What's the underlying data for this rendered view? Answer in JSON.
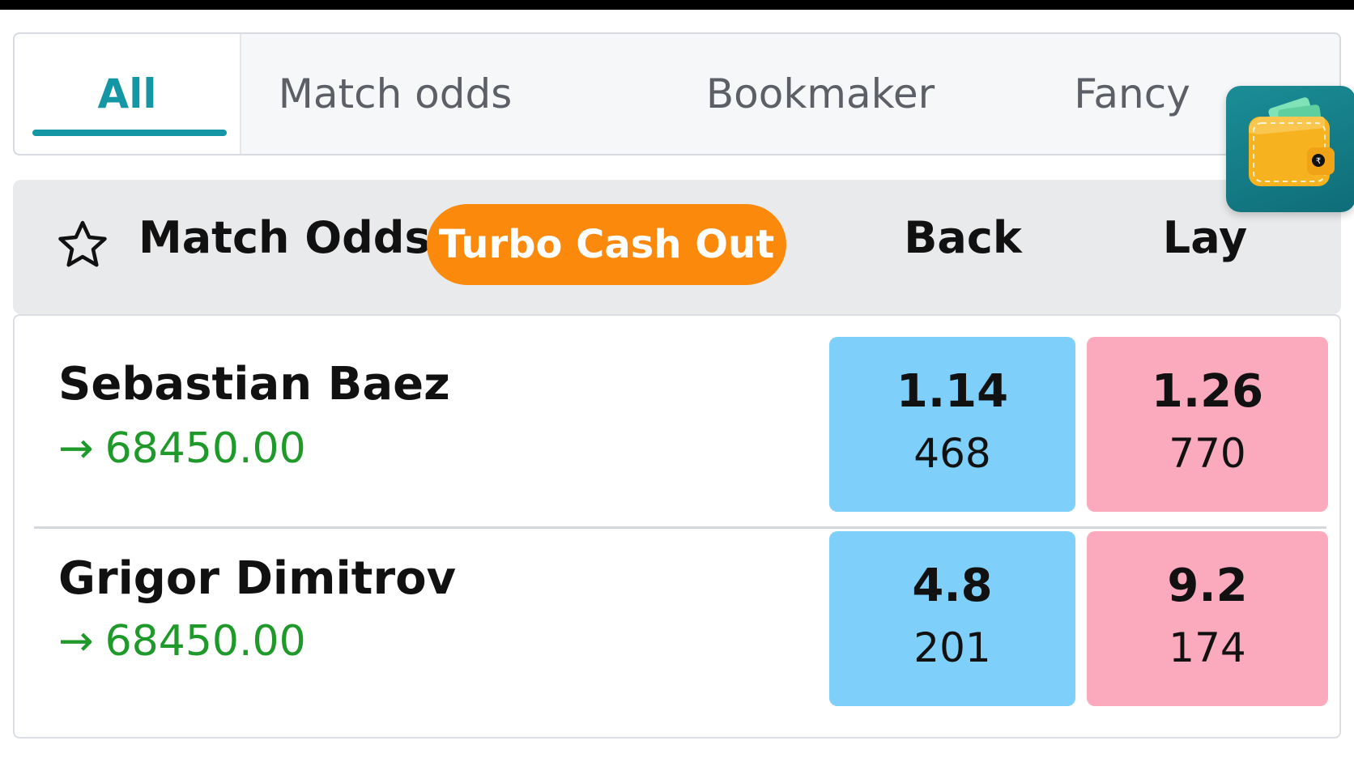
{
  "tabs": [
    {
      "label": "All",
      "active": true
    },
    {
      "label": "Match odds",
      "active": false
    },
    {
      "label": "Bookmaker",
      "active": false
    },
    {
      "label": "Fancy",
      "active": false
    }
  ],
  "wallet": {
    "icon": "wallet-icon",
    "currency_symbol": "₹"
  },
  "market": {
    "title": "Match Odds",
    "cashout_label": "Turbo Cash Out",
    "back_label": "Back",
    "lay_label": "Lay",
    "favorite_icon": "star-outline-icon"
  },
  "runners": [
    {
      "name": "Sebastian Baez",
      "arrow": "→",
      "pl": "68450.00",
      "back": {
        "price": "1.14",
        "size": "468"
      },
      "lay": {
        "price": "1.26",
        "size": "770"
      }
    },
    {
      "name": "Grigor Dimitrov",
      "arrow": "→",
      "pl": "68450.00",
      "back": {
        "price": "4.8",
        "size": "201"
      },
      "lay": {
        "price": "9.2",
        "size": "174"
      }
    }
  ],
  "colors": {
    "accent": "#1596a4",
    "cashout": "#fb8a0c",
    "back": "#7ed0fb",
    "lay": "#fbaabd",
    "profit": "#1f9a2a"
  }
}
